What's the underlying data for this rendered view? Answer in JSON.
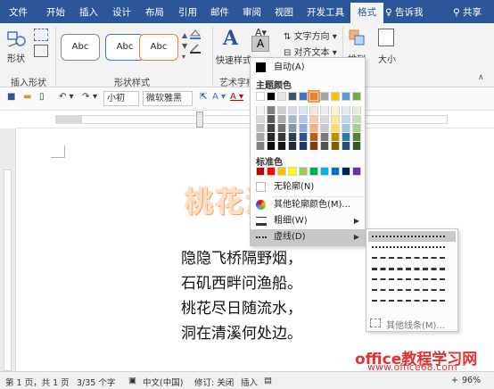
{
  "tabs": [
    {
      "label": "文件",
      "active": false
    },
    {
      "label": "开始",
      "active": false
    },
    {
      "label": "插入",
      "active": false
    },
    {
      "label": "设计",
      "active": false
    },
    {
      "label": "布局",
      "active": false
    },
    {
      "label": "引用",
      "active": false
    },
    {
      "label": "邮件",
      "active": false
    },
    {
      "label": "审阅",
      "active": false
    },
    {
      "label": "视图",
      "active": false
    },
    {
      "label": "开发工具",
      "active": false
    },
    {
      "label": "格式",
      "active": true
    }
  ],
  "tell_me": "告诉我",
  "share": "共享",
  "ribbon": {
    "shape_label": "形状",
    "insert_shapes_group": "插入形状",
    "style_boxes": [
      "Abc",
      "Abc",
      "Abc"
    ],
    "shape_styles_group": "形状样式",
    "quick_styles": "快速样式",
    "art_text_group": "艺术字样",
    "text_direction": "文字方向",
    "align_text": "对齐文本",
    "arrange": "排列",
    "size": "大小"
  },
  "qat": {
    "font_size": "小初",
    "font_name": "微软雅黑"
  },
  "document": {
    "title": "桃花溪",
    "poem": [
      "隐隐飞桥隔野烟，",
      "石矶西畔问渔船。",
      "桃花尽日随流水，",
      "洞在清溪何处边。"
    ]
  },
  "watermark": {
    "line1": "office教程学习网",
    "line2": "www.office68.com"
  },
  "status": {
    "page": "第 1 页，共 1 页",
    "words": "3/35 个字",
    "lang": "中文(中国)",
    "revise": "修订: 关闭",
    "insert": "插入",
    "zoom": "96%"
  },
  "menu": {
    "auto": "自动(A)",
    "theme_colors": "主题颜色",
    "standard_colors": "标准色",
    "no_outline": "无轮廓(N)",
    "more_colors": "其他轮廓颜色(M)...",
    "weight": "粗细(W)",
    "dashes": "虚线(D)",
    "theme_top_row": [
      "#ffffff",
      "#000000",
      "#e7e6e6",
      "#44546a",
      "#4472c4",
      "#ed7d31",
      "#a5a5a5",
      "#ffc000",
      "#5b9bd5",
      "#70ad47"
    ],
    "theme_columns": [
      [
        "#f2f2f2",
        "#d9d9d9",
        "#bfbfbf",
        "#a6a6a6",
        "#808080"
      ],
      [
        "#7f7f7f",
        "#595959",
        "#404040",
        "#262626",
        "#0d0d0d"
      ],
      [
        "#d0cece",
        "#aeabab",
        "#757070",
        "#3a3838",
        "#171616"
      ],
      [
        "#d6dce5",
        "#adb9ca",
        "#8497b0",
        "#333f50",
        "#222a35"
      ],
      [
        "#dae3f3",
        "#b4c7e7",
        "#8faadc",
        "#2f5597",
        "#1f3864"
      ],
      [
        "#fbe5d6",
        "#f8cbad",
        "#f4b183",
        "#c55a11",
        "#843c0c"
      ],
      [
        "#ededed",
        "#dbdbdb",
        "#c9c9c9",
        "#7b7b7b",
        "#525252"
      ],
      [
        "#fff2cc",
        "#ffe699",
        "#ffd966",
        "#bf9000",
        "#7f6000"
      ],
      [
        "#deebf7",
        "#bdd7ee",
        "#9dc3e6",
        "#2e75b6",
        "#1f4e79"
      ],
      [
        "#e2f0d9",
        "#c5e0b4",
        "#a9d18e",
        "#548235",
        "#385723"
      ]
    ],
    "standard": [
      "#c00000",
      "#ff0000",
      "#ffc000",
      "#ffff00",
      "#92d050",
      "#00b050",
      "#00b0f0",
      "#0070c0",
      "#002060",
      "#7030a0"
    ]
  },
  "submenu": {
    "more_lines": "其他线条(M)...",
    "dash_styles": [
      "dotted",
      "dotted",
      "dashed",
      "dashed",
      "dashed",
      "dashed",
      "dashed"
    ]
  }
}
